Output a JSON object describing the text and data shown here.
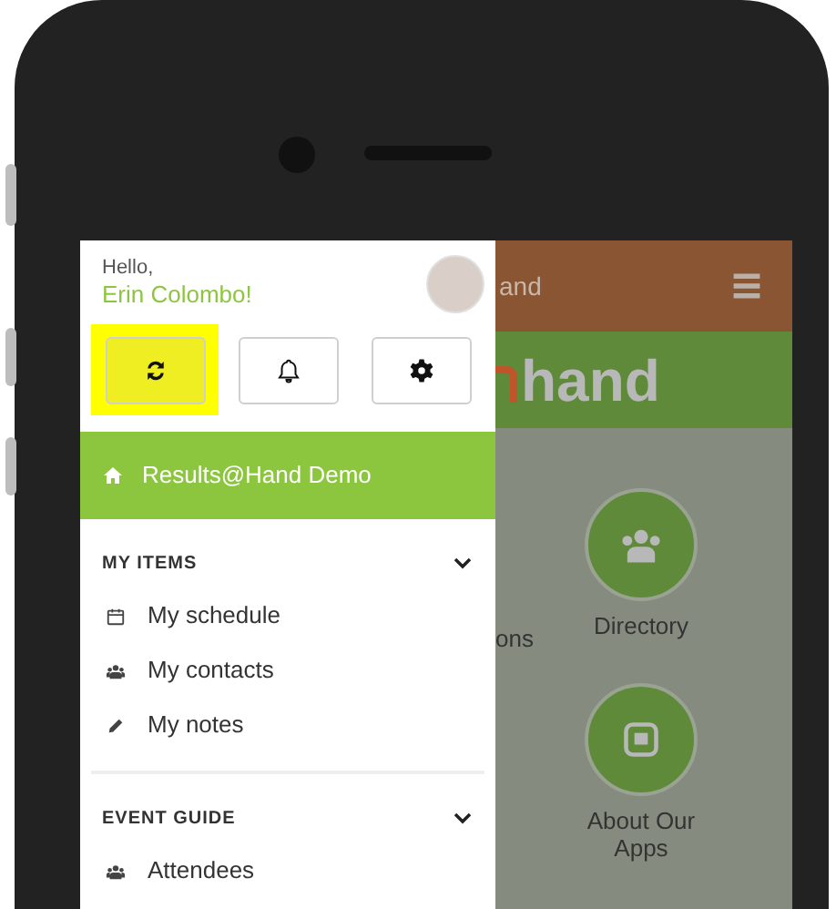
{
  "drawer": {
    "greeting": "Hello,",
    "user_name": "Erin Colombo!",
    "actions": [
      {
        "kind": "refresh",
        "highlighted": true
      },
      {
        "kind": "bell",
        "highlighted": false
      },
      {
        "kind": "settings",
        "highlighted": false
      }
    ],
    "home_item": {
      "label": "Results@Hand Demo",
      "selected": true
    },
    "sections": [
      {
        "title": "MY ITEMS",
        "expanded": true,
        "items": [
          {
            "label": "My schedule",
            "kind": "calendar"
          },
          {
            "label": "My contacts",
            "kind": "people"
          },
          {
            "label": "My notes",
            "kind": "pencil"
          }
        ]
      },
      {
        "title": "EVENT GUIDE",
        "expanded": true,
        "items": [
          {
            "label": "Attendees",
            "kind": "people"
          }
        ]
      }
    ]
  },
  "background_app": {
    "title": "and",
    "logo_text": "hand",
    "tiles": [
      {
        "label": "ons",
        "kind": "hidden"
      },
      {
        "label": "Directory",
        "kind": "people"
      },
      {
        "label": "About Our Apps",
        "kind": "at"
      }
    ]
  }
}
